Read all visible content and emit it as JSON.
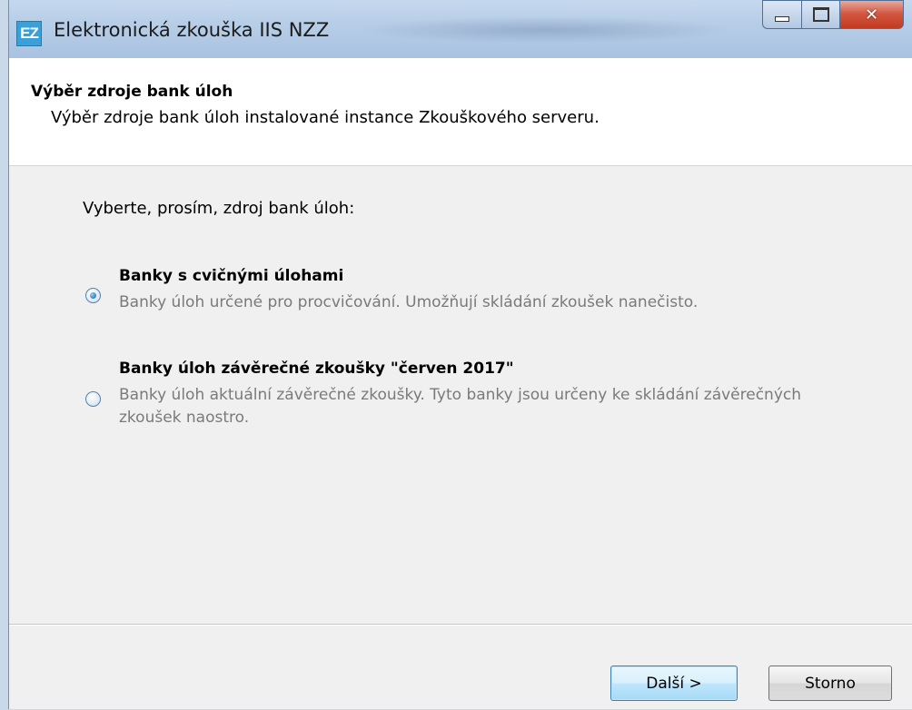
{
  "window": {
    "title": "Elektronická zkouška IIS NZZ",
    "icon_text": "EZ",
    "caption_icons": [
      "minimize-icon",
      "maximize-icon",
      "close-icon"
    ],
    "close_glyph": "✕"
  },
  "header": {
    "title": "Výběr zdroje bank úloh",
    "subtitle": "Výběr zdroje bank úloh instalované instance Zkouškového serveru."
  },
  "main": {
    "prompt": "Vyberte, prosím, zdroj bank úloh:",
    "options": [
      {
        "label": "Banky s cvičnými úlohami",
        "description": "Banky úloh určené pro procvičování. Umožňují skládání zkoušek nanečisto.",
        "selected": true
      },
      {
        "label": "Banky úloh závěrečné zkoušky \"červen 2017\"",
        "description": "Banky úloh aktuální závěrečné zkoušky. Tyto banky jsou určeny ke skládání závěrečných zkoušek naostro.",
        "selected": false
      }
    ]
  },
  "footer": {
    "next_label": "Další >",
    "cancel_label": "Storno"
  },
  "colors": {
    "titlebar": "#b9cfe8",
    "close_button": "#c23a22",
    "dialog_background": "#f0f0f0",
    "header_background": "#ffffff",
    "description_text": "#7a7a7a",
    "default_button_border": "#3c7fb1"
  }
}
